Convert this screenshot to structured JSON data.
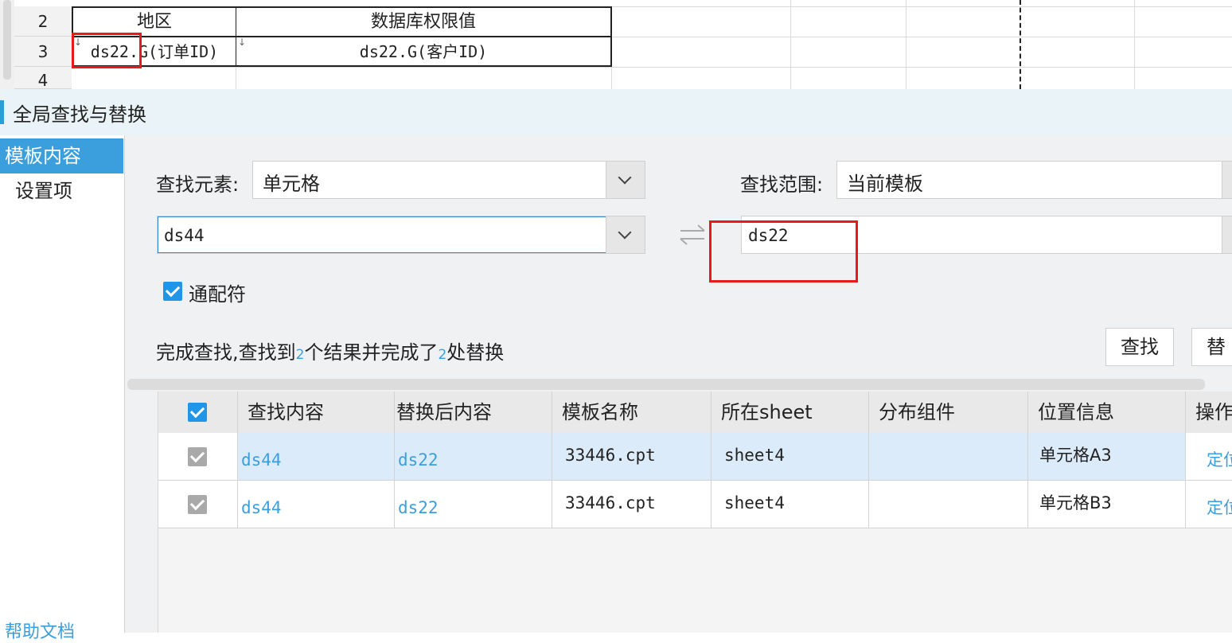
{
  "sheet": {
    "rows": [
      {
        "num": "2",
        "cells": [
          "地区",
          "数据库权限值"
        ]
      },
      {
        "num": "3",
        "cells": [
          "ds22.G(订单ID)",
          "ds22.G(客户ID)"
        ]
      },
      {
        "num": "4",
        "cells": [
          "",
          ""
        ]
      }
    ]
  },
  "dialog": {
    "title": "全局查找与替换",
    "sidebar": {
      "items": [
        {
          "label": "模板内容",
          "active": true
        },
        {
          "label": "设置项",
          "active": false
        }
      ],
      "help_label": "帮助文档"
    },
    "find_element_label": "查找元素:",
    "find_element_value": "单元格",
    "find_scope_label": "查找范围:",
    "find_scope_value": "当前模板",
    "search_value": "ds44",
    "replace_value": "ds22",
    "swap_icon": "swap-arrows-icon",
    "wildcard_label": "通配符",
    "wildcard_checked": true,
    "status_prefix": "完成查找,查找到",
    "status_count": "2",
    "status_mid": "个结果并完成了",
    "status_replaced": "2",
    "status_suffix": "处替换",
    "find_button": "查找",
    "replace_button": "替换",
    "table": {
      "headers": [
        "查找内容",
        "替换后内容",
        "模板名称",
        "所在sheet",
        "分布组件",
        "位置信息",
        "操作"
      ],
      "rows": [
        {
          "find": "ds44",
          "replace": "ds22",
          "template": "33446.cpt",
          "sheet": "sheet4",
          "component": "",
          "location": "单元格A3",
          "action": "定位"
        },
        {
          "find": "ds44",
          "replace": "ds22",
          "template": "33446.cpt",
          "sheet": "sheet4",
          "component": "",
          "location": "单元格B3",
          "action": "定位"
        }
      ]
    }
  },
  "colors": {
    "accent": "#3a9fdc",
    "highlight_red": "#e8191a",
    "selected_row": "#dcebf9"
  }
}
